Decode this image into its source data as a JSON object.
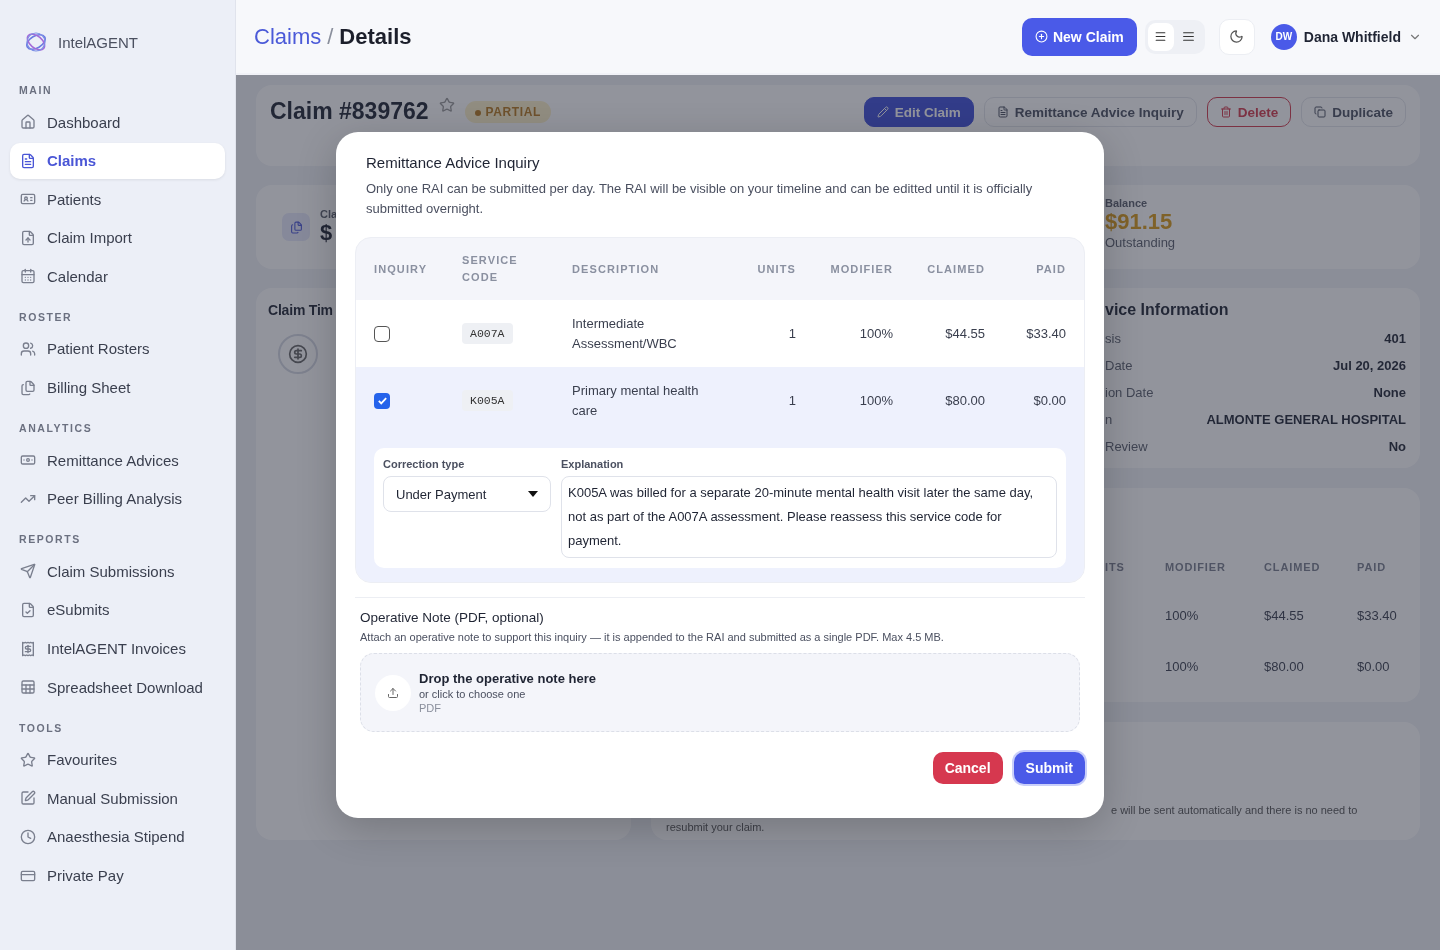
{
  "sidebar": {
    "logo": "IntelAGENT",
    "sections": [
      {
        "title": "MAIN",
        "items": [
          {
            "label": "Dashboard",
            "selected": false
          },
          {
            "label": "Claims",
            "selected": true
          },
          {
            "label": "Patients",
            "selected": false
          },
          {
            "label": "Claim Import",
            "selected": false
          },
          {
            "label": "Calendar",
            "selected": false
          }
        ]
      },
      {
        "title": "ROSTER",
        "items": [
          {
            "label": "Patient Rosters",
            "selected": false
          },
          {
            "label": "Billing Sheet",
            "selected": false
          }
        ]
      },
      {
        "title": "ANALYTICS",
        "items": [
          {
            "label": "Remittance Advices",
            "selected": false
          },
          {
            "label": "Peer Billing Analysis",
            "selected": false
          }
        ]
      },
      {
        "title": "REPORTS",
        "items": [
          {
            "label": "Claim Submissions",
            "selected": false
          },
          {
            "label": "eSubmits",
            "selected": false
          },
          {
            "label": "IntelAGENT Invoices",
            "selected": false
          },
          {
            "label": "Spreadsheet Download",
            "selected": false
          }
        ]
      },
      {
        "title": "TOOLS",
        "items": [
          {
            "label": "Favourites",
            "selected": false
          },
          {
            "label": "Manual Submission",
            "selected": false
          },
          {
            "label": "Anaesthesia Stipend",
            "selected": false
          },
          {
            "label": "Private Pay",
            "selected": false
          }
        ]
      }
    ]
  },
  "header": {
    "breadcrumb": [
      "Claims",
      "/",
      "Details"
    ],
    "new_claim": "New Claim",
    "view_options": [
      {
        "selected": true
      },
      {
        "selected": false
      }
    ],
    "user": {
      "initials": "DW",
      "name": "Dana Whitfield"
    }
  },
  "claim": {
    "title": "Claim #839762",
    "status": "PARTIAL",
    "actions": [
      {
        "label": "Edit Claim",
        "kind": "primary"
      },
      {
        "label": "Remittance Advice Inquiry",
        "kind": "outline"
      },
      {
        "label": "Delete",
        "kind": "danger"
      },
      {
        "label": "Duplicate",
        "kind": "outline"
      }
    ]
  },
  "summary": {
    "first_label": "Cla",
    "first_value": "$",
    "balance_label": "Balance",
    "balance_value": "$91.15",
    "balance_note": "Outstanding"
  },
  "timeline": {
    "title": "Claim Tim"
  },
  "service_info": {
    "title": "vice Information",
    "rows": [
      {
        "label": "sis",
        "value": "401"
      },
      {
        "label": "Date",
        "value": "Jul 20, 2026"
      },
      {
        "label": "ion Date",
        "value": "None"
      },
      {
        "label": "n",
        "value": "ALMONTE GENERAL HOSPITAL"
      },
      {
        "label": "Review",
        "value": "No"
      }
    ]
  },
  "services_table": {
    "columns": [
      "ITS",
      "MODIFIER",
      "CLAIMED",
      "PAID"
    ],
    "rows": [
      {
        "modifier": "100%",
        "claimed": "$44.55",
        "paid": "$33.40"
      },
      {
        "modifier": "100%",
        "claimed": "$80.00",
        "paid": "$0.00"
      }
    ]
  },
  "notice": {
    "line_1": "e will be sent automatically and there is no need to",
    "line_2": "resubmit your claim."
  },
  "modal": {
    "title": "Remittance Advice Inquiry",
    "description": "Only one RAI can be submitted per day. The RAI will be visible on your timeline and can be editted until it is officially submitted overnight.",
    "columns": [
      "INQUIRY",
      "SERVICE CODE",
      "DESCRIPTION",
      "UNITS",
      "MODIFIER",
      "CLAIMED",
      "PAID"
    ],
    "rows": [
      {
        "checked": false,
        "code": "A007A",
        "description": "Intermediate Assessment/WBC",
        "units": "1",
        "modifier": "100%",
        "claimed": "$44.55",
        "paid": "$33.40"
      },
      {
        "checked": true,
        "code": "K005A",
        "description": "Primary mental health care",
        "units": "1",
        "modifier": "100%",
        "claimed": "$80.00",
        "paid": "$0.00",
        "correction": {
          "type_label": "Correction type",
          "type_value": "Under Payment",
          "explanation_label": "Explanation",
          "explanation": "K005A was billed for a separate 20-minute mental health visit later the same day, not as part of the A007A assessment. Please reassess this service code for payment."
        }
      }
    ],
    "note": {
      "title": "Operative Note (PDF, optional)",
      "hint": "Attach an operative note to support this inquiry — it is appended to the RAI and submitted as a single PDF. Max 4.5 MB.",
      "drop_title": "Drop the operative note here",
      "drop_subtitle": "or click to choose one",
      "drop_types": "PDF"
    },
    "buttons": [
      {
        "label": "Cancel",
        "kind": "danger"
      },
      {
        "label": "Submit",
        "kind": "primary"
      }
    ]
  }
}
